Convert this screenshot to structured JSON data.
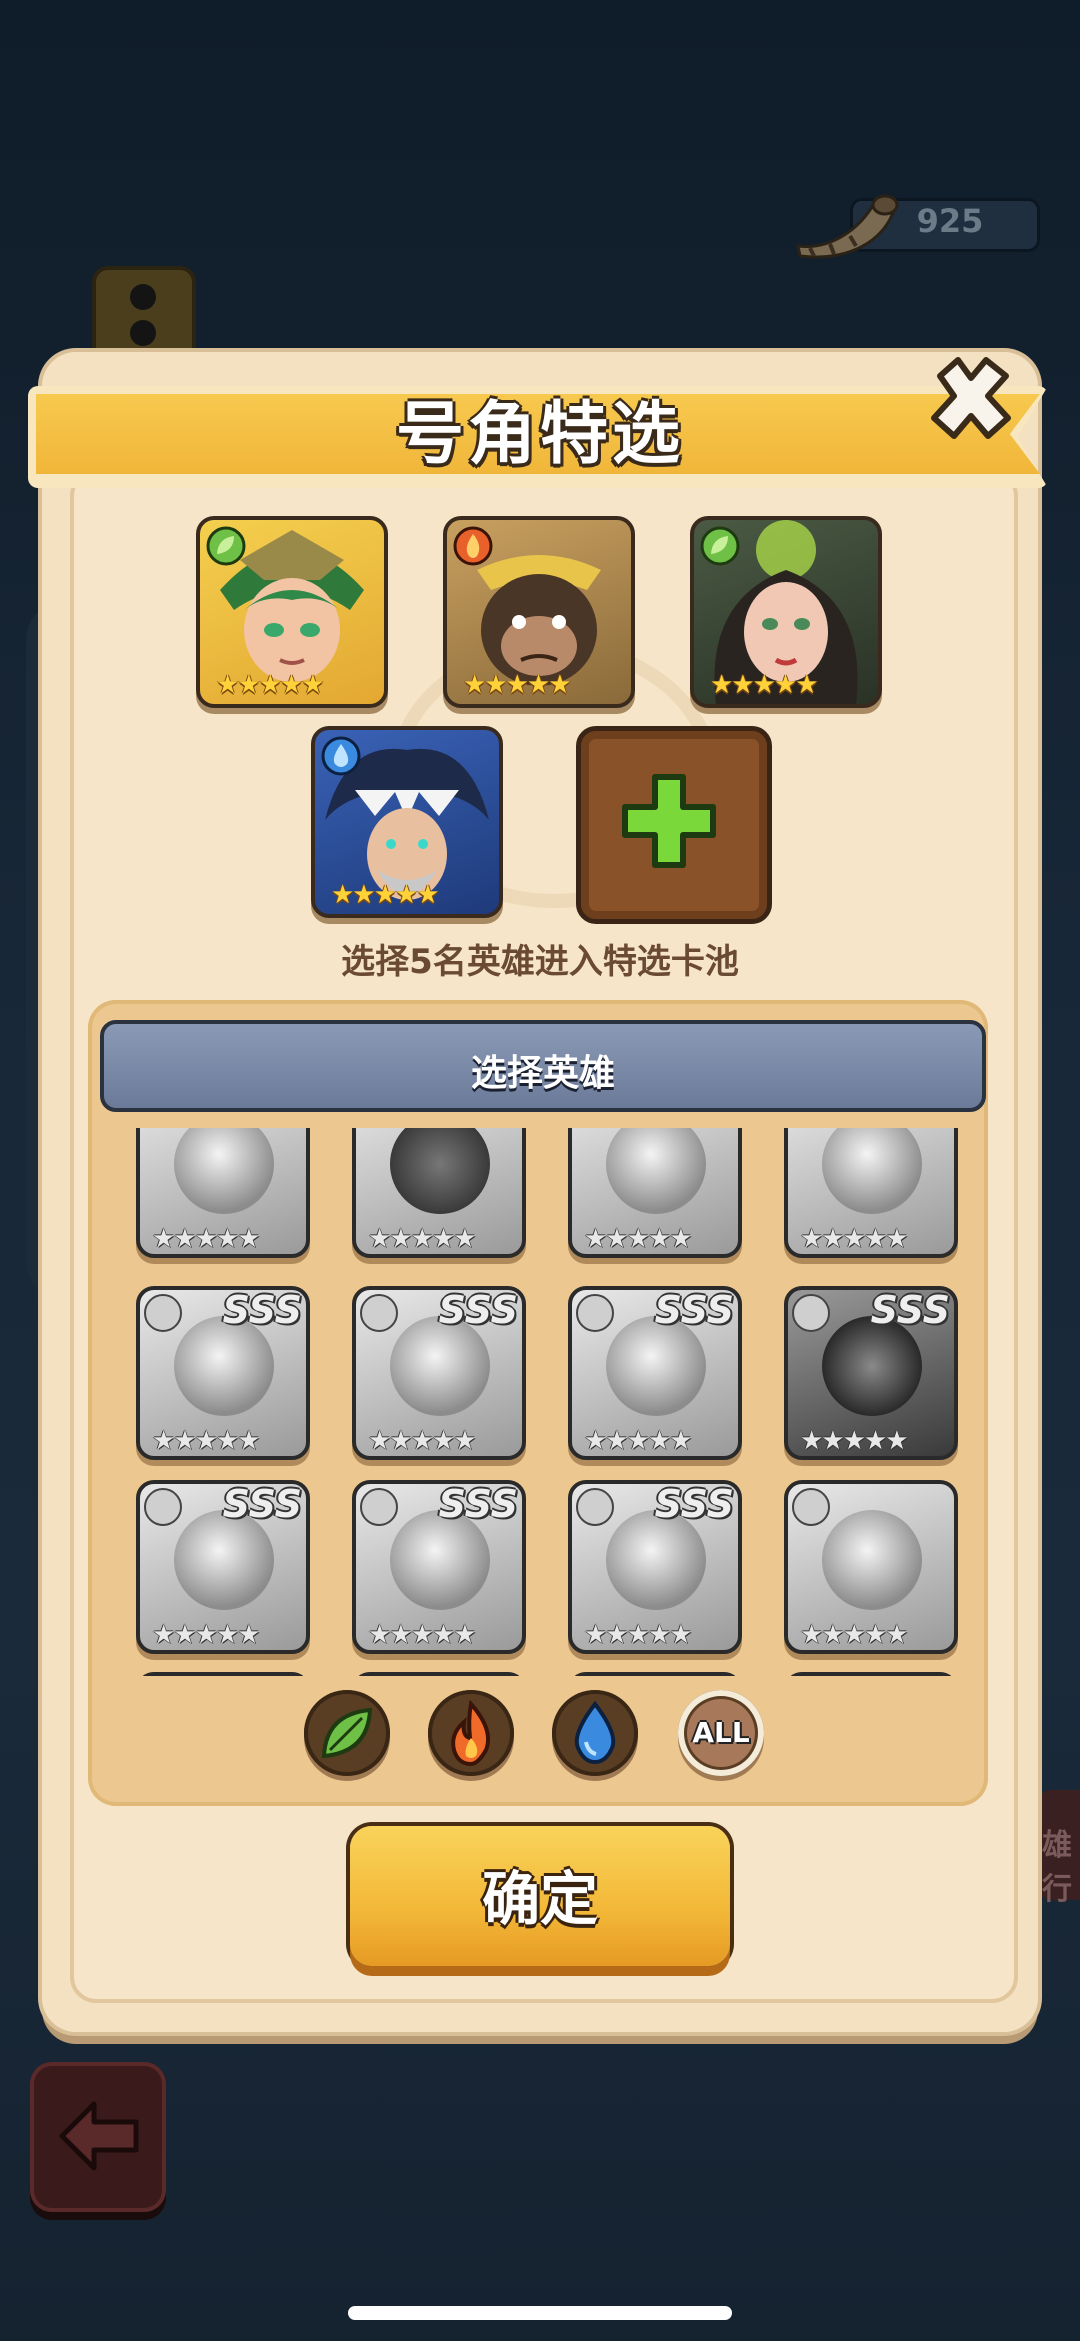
{
  "currency": {
    "icon": "horn-icon",
    "amount": "925"
  },
  "modal": {
    "title": "号角特选",
    "hint": "选择5名英雄进入特选卡池",
    "selected_heroes": [
      {
        "element": "leaf",
        "stars": "★★★★★",
        "color": "#e7b73a"
      },
      {
        "element": "fire",
        "stars": "★★★★★",
        "color": "#c5913a"
      },
      {
        "element": "leaf",
        "stars": "★★★★★",
        "color": "#3b4a3a"
      },
      {
        "element": "water",
        "stars": "★★★★★",
        "color": "#3a5aa6"
      }
    ],
    "add_slot_icon": "plus-icon",
    "selector": {
      "header": "选择英雄",
      "rank_label": "SSS",
      "rows": [
        {
          "stars": [
            "★★★★★",
            "★★★★★",
            "★★★★★",
            "★★★★★"
          ]
        },
        {
          "stars": [
            "★★★★★",
            "★★★★★",
            "★★★★★",
            "★★★★★"
          ]
        },
        {
          "stars": [
            "★★★★★",
            "★★★★★",
            "★★★★★",
            "★★★★★"
          ]
        }
      ],
      "filters": [
        "leaf-icon",
        "fire-icon",
        "water-icon"
      ],
      "filter_all": "ALL"
    },
    "confirm": "确定"
  },
  "side_label": "雄行",
  "colors": {
    "banner": "#f0b63a",
    "panel": "#f4e1c1",
    "confirm": "#f3b838"
  }
}
